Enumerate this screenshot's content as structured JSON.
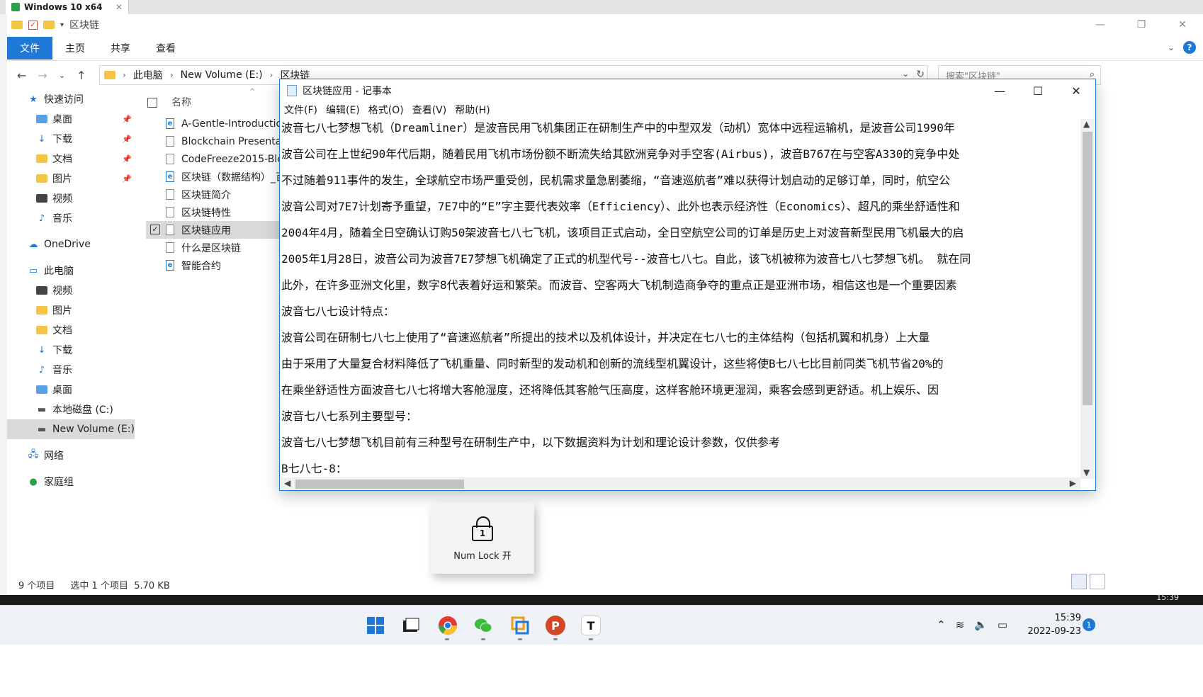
{
  "vm": {
    "tab_title": "Windows 10 x64",
    "tab_close": "✕"
  },
  "explorer": {
    "title": "区块链",
    "ribbon_tabs": [
      "文件",
      "主页",
      "共享",
      "查看"
    ],
    "address": {
      "segments": [
        "此电脑",
        "New Volume (E:)",
        "区块链"
      ]
    },
    "search_placeholder": "搜索\"区块链\"",
    "nav": [
      {
        "label": "快速访问",
        "icon": "star-icon",
        "pinned": false
      },
      {
        "label": "桌面",
        "icon": "folder-icon",
        "pinned": true
      },
      {
        "label": "下载",
        "icon": "download-folder-icon",
        "pinned": true
      },
      {
        "label": "文档",
        "icon": "documents-folder-icon",
        "pinned": true
      },
      {
        "label": "图片",
        "icon": "pictures-folder-icon",
        "pinned": true
      },
      {
        "label": "视频",
        "icon": "videos-folder-icon",
        "pinned": false
      },
      {
        "label": "音乐",
        "icon": "music-folder-icon",
        "pinned": false
      },
      {
        "label": "OneDrive",
        "icon": "cloud-icon",
        "pinned": false
      },
      {
        "label": "此电脑",
        "icon": "computer-icon",
        "pinned": false
      },
      {
        "label": "视频",
        "icon": "videos-folder-icon",
        "pinned": false
      },
      {
        "label": "图片",
        "icon": "pictures-folder-icon",
        "pinned": false
      },
      {
        "label": "文档",
        "icon": "documents-folder-icon",
        "pinned": false
      },
      {
        "label": "下载",
        "icon": "download-folder-icon",
        "pinned": false
      },
      {
        "label": "音乐",
        "icon": "music-folder-icon",
        "pinned": false
      },
      {
        "label": "桌面",
        "icon": "folder-icon",
        "pinned": false
      },
      {
        "label": "本地磁盘 (C:)",
        "icon": "drive-icon",
        "pinned": false
      },
      {
        "label": "New Volume (E:)",
        "icon": "drive-icon",
        "pinned": false
      },
      {
        "label": "网络",
        "icon": "network-icon",
        "pinned": false
      },
      {
        "label": "家庭组",
        "icon": "homegroup-icon",
        "pinned": false
      }
    ],
    "column_name": "名称",
    "files": [
      {
        "name": "A-Gentle-Introductio",
        "icon": "ie-document-icon"
      },
      {
        "name": "Blockchain Presentat",
        "icon": "blank-document-icon"
      },
      {
        "name": "CodeFreeze2015-Blo",
        "icon": "blank-document-icon"
      },
      {
        "name": "区块链（数据结构）_百",
        "icon": "ie-document-icon"
      },
      {
        "name": "区块链简介",
        "icon": "text-document-icon"
      },
      {
        "name": "区块链特性",
        "icon": "text-document-icon"
      },
      {
        "name": "区块链应用",
        "icon": "text-document-icon"
      },
      {
        "name": "什么是区块链",
        "icon": "text-document-icon"
      },
      {
        "name": "智能合约",
        "icon": "ie-document-icon"
      }
    ],
    "status": {
      "count": "9 个项目",
      "selected": "选中 1 个项目",
      "size": "5.70 KB"
    }
  },
  "notepad": {
    "title": "区块链应用 - 记事本",
    "menu": [
      "文件(F)",
      "编辑(E)",
      "格式(O)",
      "查看(V)",
      "帮助(H)"
    ],
    "lines": [
      "       波音七八七梦想飞机（Dreamliner）是波音民用飞机集团正在研制生产中的中型双发（动机）宽体中远程运输机，是波音公司1990年",
      "       波音公司在上世纪90年代后期，随着民用飞机市场份额不断流失给其欧洲竞争对手空客(Airbus)，波音B767在与空客A330的竞争中处",
      "  不过随着911事件的发生，全球航空市场严重受创，民机需求量急剧萎缩，“音速巡航者”难以获得计划启动的足够订单，同时，航空公",
      "  波音公司对7E7计划寄予重望，7E7中的“E”字主要代表效率（Efficiency）、此外也表示经济性（Economics）、超凡的乘坐舒适性和",
      "  2004年4月，随着全日空确认订购50架波音七八七飞机，该项目正式启动，全日空航空公司的订单是历史上对波音新型民用飞机最大的启",
      "  2005年1月28日，波音公司为波音7E7梦想飞机确定了正式的机型代号--波音七八七。自此，该飞机被称为波音七八七梦想飞机。 就在同",
      "  此外，在许多亚洲文化里，数字8代表着好运和繁荣。而波音、空客两大飞机制造商争夺的重点正是亚洲市场，相信这也是一个重要因素",
      "波音七八七设计特点：",
      "      波音公司在研制七八七上使用了“音速巡航者”所提出的技术以及机体设计，并决定在七八七的主体结构（包括机翼和机身）上大量",
      "      由于采用了大量复合材料降低了飞机重量、同时新型的发动机和创新的流线型机翼设计，这些将使B七八七比目前同类飞机节省20%的",
      "      在乘坐舒适性方面波音七八七将增大客舱湿度，还将降低其客舱气压高度，这样客舱环境更湿润，乘客会感到更舒适。机上娱乐、因",
      "波音七八七系列主要型号：",
      "波音七八七梦想飞机目前有三种型号在研制生产中，以下数据资料为计划和理论设计参数，仅供参考",
      "B七八七-8："
    ]
  },
  "numlock": {
    "digit": "1",
    "label": "Num Lock 开"
  },
  "dark_strip_time": "15:39",
  "taskbar": {
    "apps": [
      {
        "name": "windows-start-icon",
        "color": "#1e78d6",
        "glyph": ""
      },
      {
        "name": "file-manager-icon",
        "color": "#333333",
        "glyph": ""
      },
      {
        "name": "chrome-icon",
        "color": "#2e9d4b",
        "glyph": ""
      },
      {
        "name": "wechat-icon",
        "color": "#3dbb3d",
        "glyph": ""
      },
      {
        "name": "vmware-icon",
        "color": "#f29d1a",
        "glyph": ""
      },
      {
        "name": "powerpoint-icon",
        "color": "#d24726",
        "glyph": "P"
      },
      {
        "name": "typora-icon",
        "color": "#ffffff",
        "glyph": "T"
      }
    ],
    "time": "15:39",
    "date": "2022-09-23",
    "notifications": "1"
  },
  "colors": {
    "accent": "#1e78d6",
    "selection": "#d9d9d9"
  }
}
